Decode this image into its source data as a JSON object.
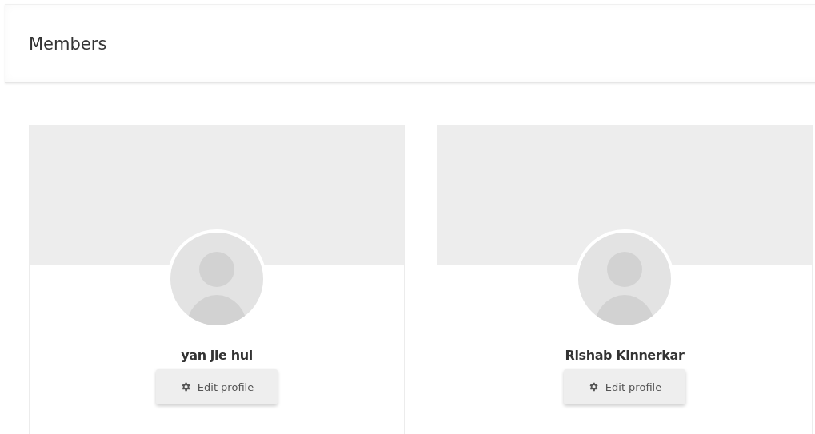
{
  "page_title": "Members",
  "members": [
    {
      "name": "yan jie hui",
      "action": "Edit profile"
    },
    {
      "name": "Rishab Kinnerkar",
      "action": "Edit profile"
    }
  ]
}
